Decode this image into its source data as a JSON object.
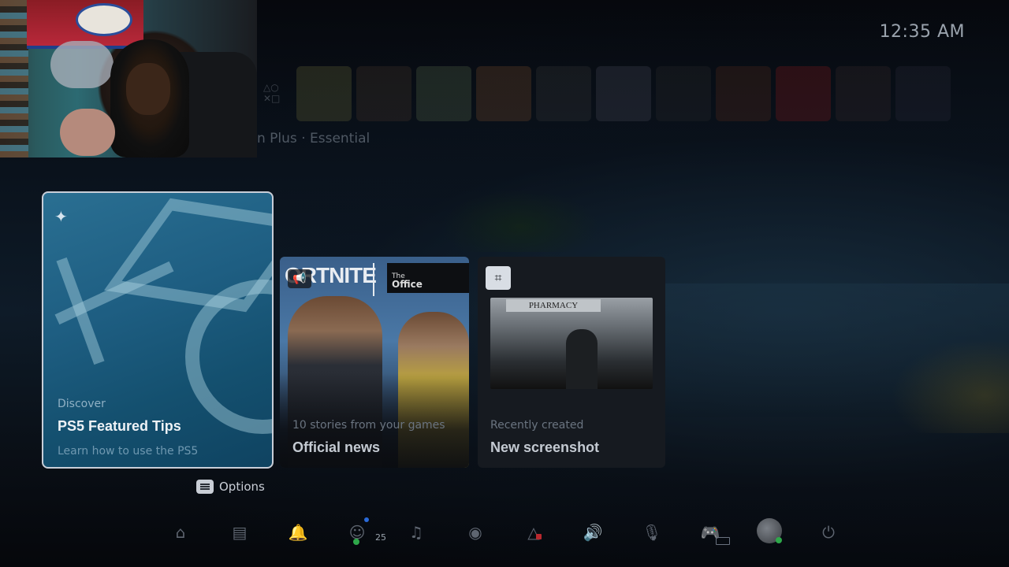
{
  "clock": {
    "time": "12:35 AM"
  },
  "strip": {
    "label": "n Plus · Essential"
  },
  "featured_card": {
    "kicker": "Discover",
    "title": "PS5 Featured Tips",
    "subtitle": "Learn how to use the PS5"
  },
  "news_card": {
    "game_logo": "ORTNITE",
    "partner_small": "The",
    "partner_big": "Office",
    "kicker": "10 stories from your games",
    "title": "Official news"
  },
  "screenshot_card": {
    "sign_text": "PHARMACY",
    "kicker": "Recently created",
    "title": "New screenshot"
  },
  "options": {
    "label": "Options"
  },
  "control_center": {
    "friends_online_count": "25",
    "icons": [
      "home-icon",
      "game-library-icon",
      "notifications-icon",
      "game-base-icon",
      "music-icon",
      "remote-play-icon",
      "accessibility-icon",
      "sound-icon",
      "mic-icon",
      "controller-icon",
      "profile-avatar",
      "power-icon"
    ]
  },
  "colors": {
    "background": "#05070b",
    "featured_card": "#1e5e82",
    "online_green": "#2ea84a",
    "accent_blue": "#2a6ad8"
  }
}
